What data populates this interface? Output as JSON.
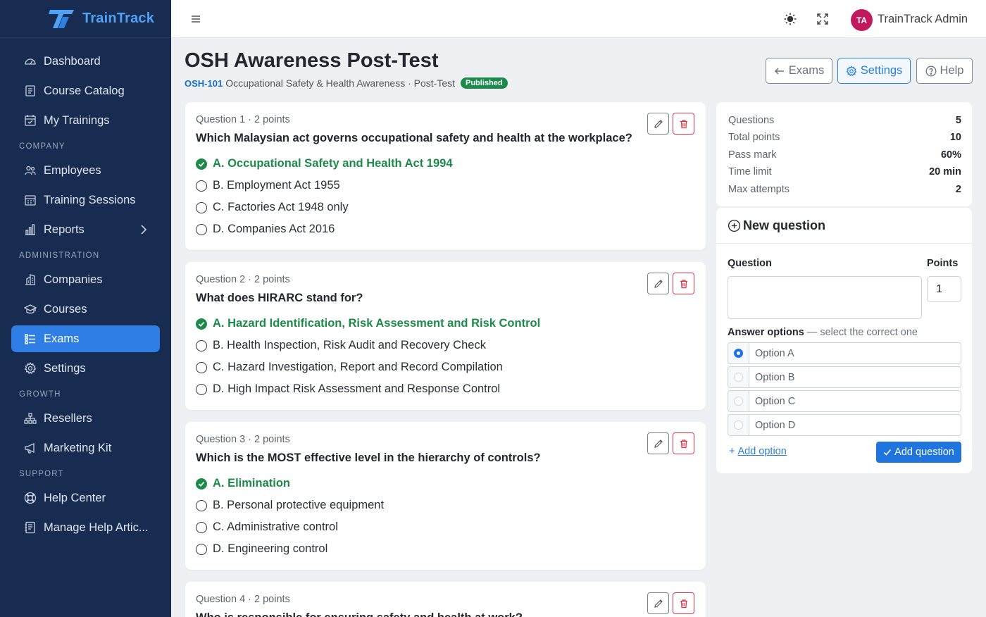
{
  "brand": {
    "name": "TrainTrack"
  },
  "sidebar": {
    "items": [
      {
        "label": "Dashboard",
        "icon": "dashboard-icon"
      },
      {
        "label": "Course Catalog",
        "icon": "catalog-icon"
      },
      {
        "label": "My Trainings",
        "icon": "calendar-check-icon"
      }
    ],
    "sections": [
      "COMPANY",
      "ADMINISTRATION",
      "GROWTH",
      "SUPPORT"
    ],
    "company": [
      {
        "label": "Employees",
        "icon": "people-icon"
      },
      {
        "label": "Training Sessions",
        "icon": "calendar-icon"
      },
      {
        "label": "Reports",
        "icon": "bar-chart-icon"
      }
    ],
    "administration": [
      {
        "label": "Companies",
        "icon": "building-icon"
      },
      {
        "label": "Courses",
        "icon": "mortarboard-icon"
      },
      {
        "label": "Exams",
        "icon": "list-check-icon",
        "active": true
      },
      {
        "label": "Settings",
        "icon": "gear-icon"
      }
    ],
    "growth": [
      {
        "label": "Resellers",
        "icon": "diagram-icon"
      },
      {
        "label": "Marketing Kit",
        "icon": "megaphone-icon"
      }
    ],
    "support": [
      {
        "label": "Help Center",
        "icon": "lifebuoy-icon"
      },
      {
        "label": "Manage Help Artic...",
        "icon": "journal-icon"
      }
    ]
  },
  "topbar": {
    "avatar_initials": "TA",
    "user_name": "TrainTrack Admin"
  },
  "page": {
    "title": "OSH Awareness Post-Test",
    "code": "OSH-101",
    "subtitle": "Occupational Safety & Health Awareness · Post-Test",
    "status": "Published",
    "buttons": {
      "back": "Exams",
      "settings": "Settings",
      "help": "Help"
    }
  },
  "questions": [
    {
      "meta": "Question 1 · 2 points",
      "text": "Which Malaysian act governs occupational safety and health at the workplace?",
      "options": [
        "A. Occupational Safety and Health Act 1994",
        "B. Employment Act 1955",
        "C. Factories Act 1948 only",
        "D. Companies Act 2016"
      ]
    },
    {
      "meta": "Question 2 · 2 points",
      "text": "What does HIRARC stand for?",
      "options": [
        "A. Hazard Identification, Risk Assessment and Risk Control",
        "B. Health Inspection, Risk Audit and Recovery Check",
        "C. Hazard Investigation, Report and Record Compilation",
        "D. High Impact Risk Assessment and Response Control"
      ]
    },
    {
      "meta": "Question 3 · 2 points",
      "text": "Which is the MOST effective level in the hierarchy of controls?",
      "options": [
        "A. Elimination",
        "B. Personal protective equipment",
        "C. Administrative control",
        "D. Engineering control"
      ]
    },
    {
      "meta": "Question 4 · 2 points",
      "text": "Who is responsible for ensuring safety and health at work?"
    }
  ],
  "summary": {
    "rows": [
      {
        "label": "Questions",
        "value": "5"
      },
      {
        "label": "Total points",
        "value": "10"
      },
      {
        "label": "Pass mark",
        "value": "60%"
      },
      {
        "label": "Time limit",
        "value": "20 min"
      },
      {
        "label": "Max attempts",
        "value": "2"
      }
    ]
  },
  "new_question": {
    "title": "New question",
    "question_label": "Question",
    "question_value": "",
    "points_label": "Points",
    "points_value": "1",
    "answer_label": "Answer options",
    "answer_hint": " — select the correct one",
    "options": [
      "Option A",
      "Option B",
      "Option C",
      "Option D"
    ],
    "add_option": "Add option",
    "add_question": "Add question"
  },
  "colors": {
    "sidebar_bg": "#182c51",
    "accent": "#2f7ee6",
    "correct": "#1d8a4a",
    "danger": "#dc3545",
    "avatar": "#c1185e"
  }
}
